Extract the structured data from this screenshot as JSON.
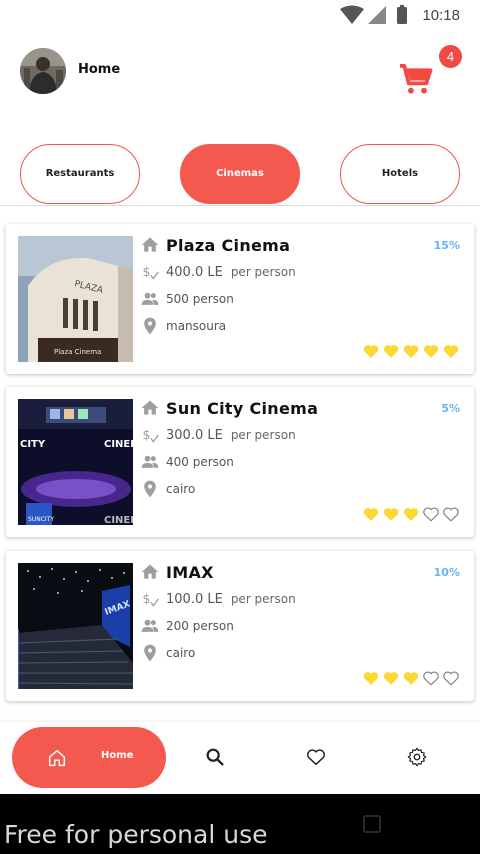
{
  "status": {
    "time": "10:18"
  },
  "header": {
    "title": "Home",
    "cart_count": "4"
  },
  "categories": [
    {
      "label": "Restaurants",
      "active": false
    },
    {
      "label": "Cinemas",
      "active": true
    },
    {
      "label": "Hotels",
      "active": false
    }
  ],
  "listings": [
    {
      "name": "Plaza Cinema",
      "price": "400.0 LE",
      "unit": "per person",
      "capacity": "500 person",
      "location": "mansoura",
      "discount": "15%",
      "rating": 5
    },
    {
      "name": "Sun City Cinema",
      "price": "300.0 LE",
      "unit": "per person",
      "capacity": "400 person",
      "location": "cairo",
      "discount": "5%",
      "rating": 3
    },
    {
      "name": "IMAX",
      "price": "100.0 LE",
      "unit": "per person",
      "capacity": "200 person",
      "location": "cairo",
      "discount": "10%",
      "rating": 3
    }
  ],
  "bottom_nav": {
    "home_label": "Home"
  },
  "watermark": "Free for personal use",
  "colors": {
    "accent": "#f4594f",
    "star": "#fdd835",
    "discount": "#64b5f6"
  }
}
